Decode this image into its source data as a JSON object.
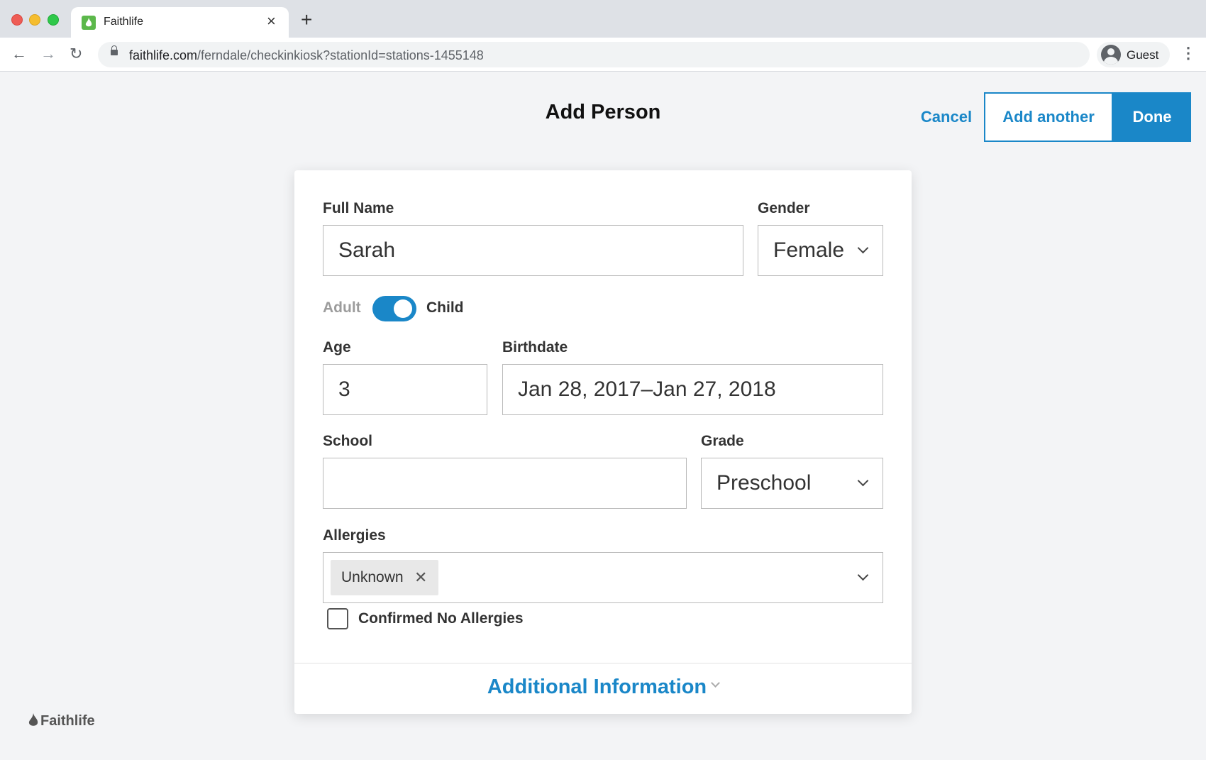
{
  "browser": {
    "tab_title": "Faithlife",
    "url_host": "faithlife.com",
    "url_path": "/ferndale/checkinkiosk?stationId=stations-1455148",
    "profile_label": "Guest"
  },
  "header": {
    "title": "Add Person",
    "cancel_label": "Cancel",
    "add_another_label": "Add another",
    "done_label": "Done"
  },
  "form": {
    "full_name_label": "Full Name",
    "full_name_value": "Sarah",
    "gender_label": "Gender",
    "gender_value": "Female",
    "toggle_off_label": "Adult",
    "toggle_on_label": "Child",
    "age_label": "Age",
    "age_value": "3",
    "birthdate_label": "Birthdate",
    "birthdate_value": "Jan 28, 2017–Jan 27, 2018",
    "school_label": "School",
    "school_value": "",
    "grade_label": "Grade",
    "grade_value": "Preschool",
    "allergies_label": "Allergies",
    "allergy_tags": [
      "Unknown"
    ],
    "confirmed_label": "Confirmed No Allergies",
    "additional_label": "Additional Information"
  },
  "footer": {
    "brand": "Faithlife"
  },
  "colors": {
    "accent": "#1a87c8",
    "background": "#f3f4f6"
  }
}
